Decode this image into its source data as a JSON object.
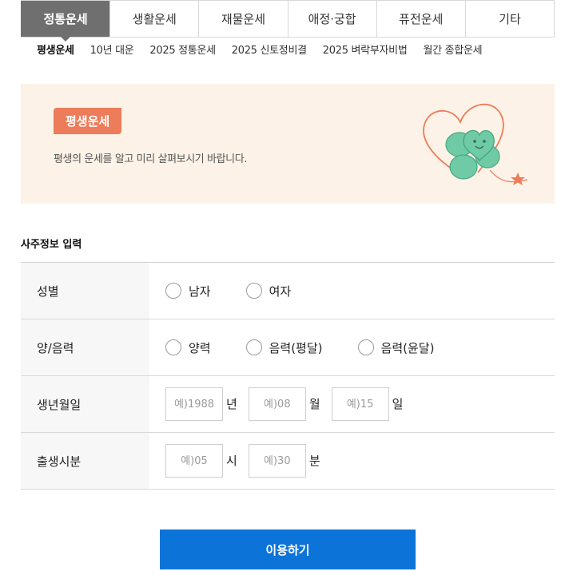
{
  "tabs": [
    {
      "label": "정통운세",
      "active": true
    },
    {
      "label": "생활운세"
    },
    {
      "label": "재물운세"
    },
    {
      "label": "애정·궁합"
    },
    {
      "label": "퓨전운세"
    },
    {
      "label": "기타"
    }
  ],
  "subtabs": [
    {
      "label": "평생운세",
      "active": true
    },
    {
      "label": "10년 대운"
    },
    {
      "label": "2025 정통운세"
    },
    {
      "label": "2025 신토정비결"
    },
    {
      "label": "2025 벼락부자비법"
    },
    {
      "label": "월간 종합운세"
    }
  ],
  "banner": {
    "badge": "평생운세",
    "description": "평생의 운세를 알고 미리 살펴보시기 바랍니다.",
    "accent_color": "#ec7c5a",
    "clover_color": "#6fcba5"
  },
  "section_title": "사주정보 입력",
  "form": {
    "gender": {
      "label": "성별",
      "options": [
        "남자",
        "여자"
      ]
    },
    "calendar": {
      "label": "양/음력",
      "options": [
        "양력",
        "음력(평달)",
        "음력(윤달)"
      ]
    },
    "birth_date": {
      "label": "생년월일",
      "year_placeholder": "예)1988",
      "year_unit": "년",
      "month_placeholder": "예)08",
      "month_unit": "월",
      "day_placeholder": "예)15",
      "day_unit": "일"
    },
    "birth_time": {
      "label": "출생시분",
      "hour_placeholder": "예)05",
      "hour_unit": "시",
      "minute_placeholder": "예)30",
      "minute_unit": "분"
    }
  },
  "submit_label": "이용하기",
  "submit_color": "#0c74d8"
}
